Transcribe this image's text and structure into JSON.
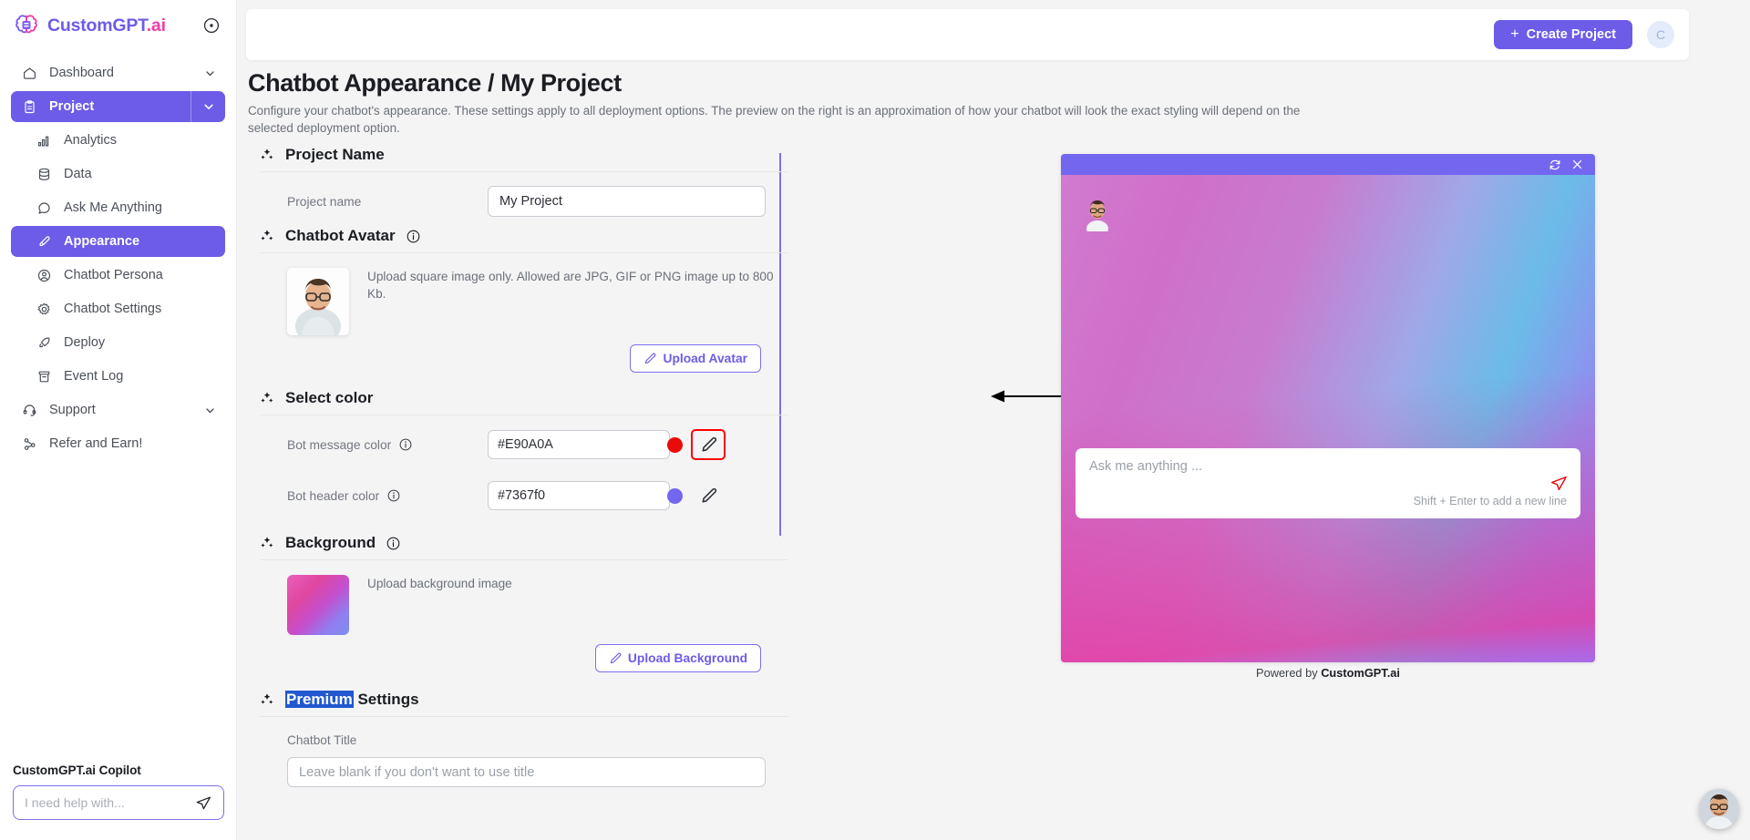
{
  "brand": {
    "name_part1": "CustomGPT",
    "name_part2": ".ai",
    "collapse_icon": "circle-dot-icon"
  },
  "sidebar": {
    "items": [
      {
        "label": "Dashboard",
        "icon": "home-icon",
        "chevron": true,
        "level": "top",
        "active": false
      },
      {
        "label": "Project",
        "icon": "clipboard-icon",
        "chevron": true,
        "level": "top",
        "active": true
      },
      {
        "label": "Analytics",
        "icon": "bar-chart-icon",
        "chevron": false,
        "level": "sub",
        "active": false
      },
      {
        "label": "Data",
        "icon": "database-icon",
        "chevron": false,
        "level": "sub",
        "active": false
      },
      {
        "label": "Ask Me Anything",
        "icon": "chat-bubble-icon",
        "chevron": false,
        "level": "sub",
        "active": false
      },
      {
        "label": "Appearance",
        "icon": "brush-icon",
        "chevron": false,
        "level": "sub",
        "active": true
      },
      {
        "label": "Chatbot Persona",
        "icon": "user-circle-icon",
        "chevron": false,
        "level": "sub",
        "active": false
      },
      {
        "label": "Chatbot Settings",
        "icon": "gear-icon",
        "chevron": false,
        "level": "sub",
        "active": false
      },
      {
        "label": "Deploy",
        "icon": "rocket-icon",
        "chevron": false,
        "level": "sub",
        "active": false
      },
      {
        "label": "Event Log",
        "icon": "archive-icon",
        "chevron": false,
        "level": "sub",
        "active": false
      },
      {
        "label": "Support",
        "icon": "headset-icon",
        "chevron": true,
        "level": "top",
        "active": false
      },
      {
        "label": "Refer and Earn!",
        "icon": "share-nodes-icon",
        "chevron": false,
        "level": "top",
        "active": false
      }
    ],
    "copilot": {
      "title": "CustomGPT.ai Copilot",
      "placeholder": "I need help with...",
      "value": "",
      "send_icon": "send-paper-plane-icon"
    }
  },
  "topbar": {
    "create_project_label": "Create Project",
    "create_project_plus": "+",
    "user_avatar_initial": "C"
  },
  "page": {
    "title": "Chatbot Appearance / My Project",
    "description": "Configure your chatbot's appearance. These settings apply to all deployment options. The preview on the right is an approximation of how your chatbot will look the exact styling will depend on the selected deployment option."
  },
  "sections": {
    "project_name": {
      "heading": "Project Name",
      "field_label": "Project name",
      "value": "My Project",
      "placeholder": ""
    },
    "chatbot_avatar": {
      "heading": "Chatbot Avatar",
      "has_info": true,
      "note": "Upload square image only. Allowed are JPG, GIF or PNG image up to 800 Kb.",
      "upload_button": "Upload Avatar"
    },
    "select_color": {
      "heading": "Select color",
      "rows": [
        {
          "label": "Bot message color",
          "value": "#E90A0A",
          "swatch": "#E90A0A",
          "has_info": true,
          "edit_icon": "pencil-icon",
          "highlighted": true
        },
        {
          "label": "Bot header color",
          "value": "#7367f0",
          "swatch": "#7367f0",
          "has_info": true,
          "edit_icon": "pencil-icon",
          "highlighted": false
        }
      ]
    },
    "background": {
      "heading": "Background",
      "has_info": true,
      "note": "Upload background image",
      "upload_button": "Upload Background"
    },
    "premium_settings": {
      "heading_highlighted": "Premium",
      "heading_rest": " Settings",
      "field_label": "Chatbot Title",
      "placeholder": "Leave blank if you don't want to use title",
      "value": ""
    }
  },
  "preview": {
    "refresh_icon": "refresh-icon",
    "close_icon": "close-x-icon",
    "header_color": "#7367f0",
    "bot_avatar": "bot-avatar-image",
    "input_placeholder": "Ask me anything ...",
    "input_value": "",
    "hint": "Shift + Enter to add a new line",
    "send_icon": "send-paper-plane-icon",
    "send_icon_color": "#E90A0A",
    "powered_prefix": "Powered by ",
    "powered_brand": "CustomGPT.ai"
  },
  "fab": {
    "icon": "chat-widget-avatar-icon"
  },
  "annotation": {
    "arrow": "pointer-arrow-left",
    "highlight_color": "#ff0000"
  }
}
